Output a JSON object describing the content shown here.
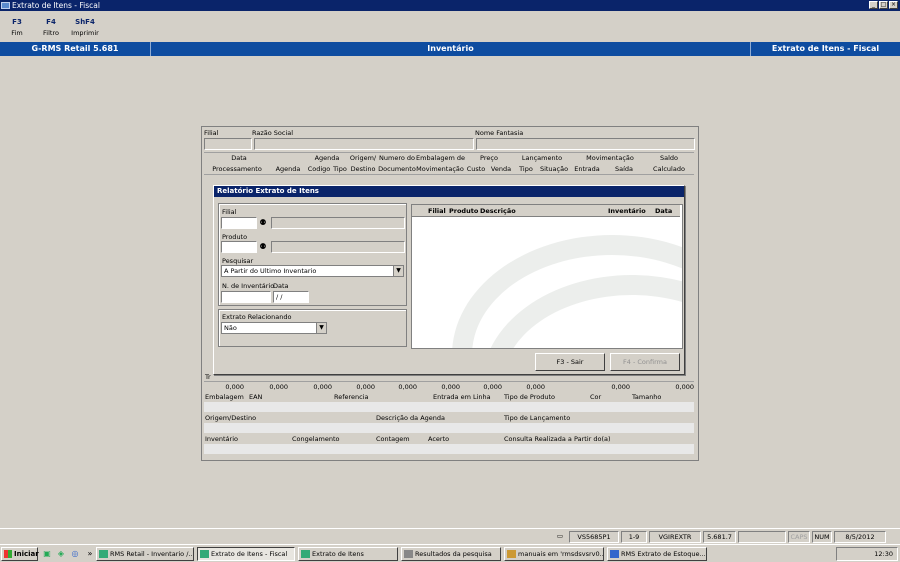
{
  "window": {
    "title": "Extrato de Itens - Fiscal",
    "controls": [
      "_",
      "□",
      "×"
    ]
  },
  "fkeys": [
    {
      "key": "F3",
      "label": "Fim"
    },
    {
      "key": "F4",
      "label": "Filtro"
    },
    {
      "key": "ShF4",
      "label": "Imprimir"
    }
  ],
  "header": {
    "version": "G-RMS Retail 5.681",
    "module": "Inventário",
    "screen": "Extrato de Itens - Fiscal"
  },
  "main": {
    "filial_label": "Filial",
    "razao_label": "Razão Social",
    "fantasia_label": "Nome Fantasia",
    "grid_top": [
      "Data",
      "Agenda",
      "Origem/",
      "Numero do",
      "Embalagem de",
      "Preço",
      "Lançamento",
      "Movimentação",
      "Saldo"
    ],
    "grid_sub": [
      "Processamento",
      "Agenda",
      "Codigo",
      "Tipo",
      "Destino",
      "Documento",
      "Movimentação",
      "Custo",
      "Venda",
      "Tipo",
      "Situação",
      "Entrada",
      "Saída",
      "Calculado"
    ],
    "tr_label": "Tr",
    "totals": [
      "0,000",
      "0,000",
      "0,000",
      "0,000",
      "0,000",
      "0,000",
      "0,000",
      "0,000",
      "0,000",
      "0,000"
    ],
    "detail_row1": [
      "Embalagem",
      "EAN",
      "Referencia",
      "Entrada em Linha",
      "Tipo de Produto",
      "Cor",
      "Tamanho"
    ],
    "detail_row2": [
      "Origem/Destino",
      "Descrição da Agenda",
      "Tipo de Lançamento"
    ],
    "detail_row3": [
      "Inventário",
      "Congelamento",
      "Contagem",
      "Acerto",
      "Consulta Realizada a Partir do(a)"
    ]
  },
  "dialog": {
    "title": "Relatório Extrato de Itens",
    "filial_label": "Filial",
    "produto_label": "Produto",
    "pesquisar_label": "Pesquisar",
    "pesquisar_value": "A Partir do Ultimo Inventario",
    "ninv_label": "N. de Inventário",
    "data_label": "Data",
    "data_value": " / /",
    "extrato_label": "Extrato Relacionando",
    "extrato_value": "Não",
    "list_headers": [
      "Filial",
      "Produto",
      "Descrição",
      "Inventário",
      "Data"
    ],
    "btn_sair": "F3 - Sair",
    "btn_confirma": "F4 - Confirma"
  },
  "statusbar": [
    "VS5685P1",
    "1-9",
    "VGIREXTR",
    "5.681.7",
    "CAPS",
    "NUM",
    "8/5/2012"
  ],
  "taskbar": {
    "start": "Iniciar",
    "items": [
      "RMS Retail - Inventario /...",
      "Extrato de Itens - Fiscal",
      "Extrato de Itens",
      "Resultados da pesquisa",
      "manuais em 'rmsdsvsrv0...",
      "RMS Extrato de Estoque..."
    ],
    "clock": "12:30"
  },
  "colors": {
    "titlebar": "#0a246a",
    "header_bar": "#0e4ca0",
    "window_bg": "#d4d0c8"
  }
}
